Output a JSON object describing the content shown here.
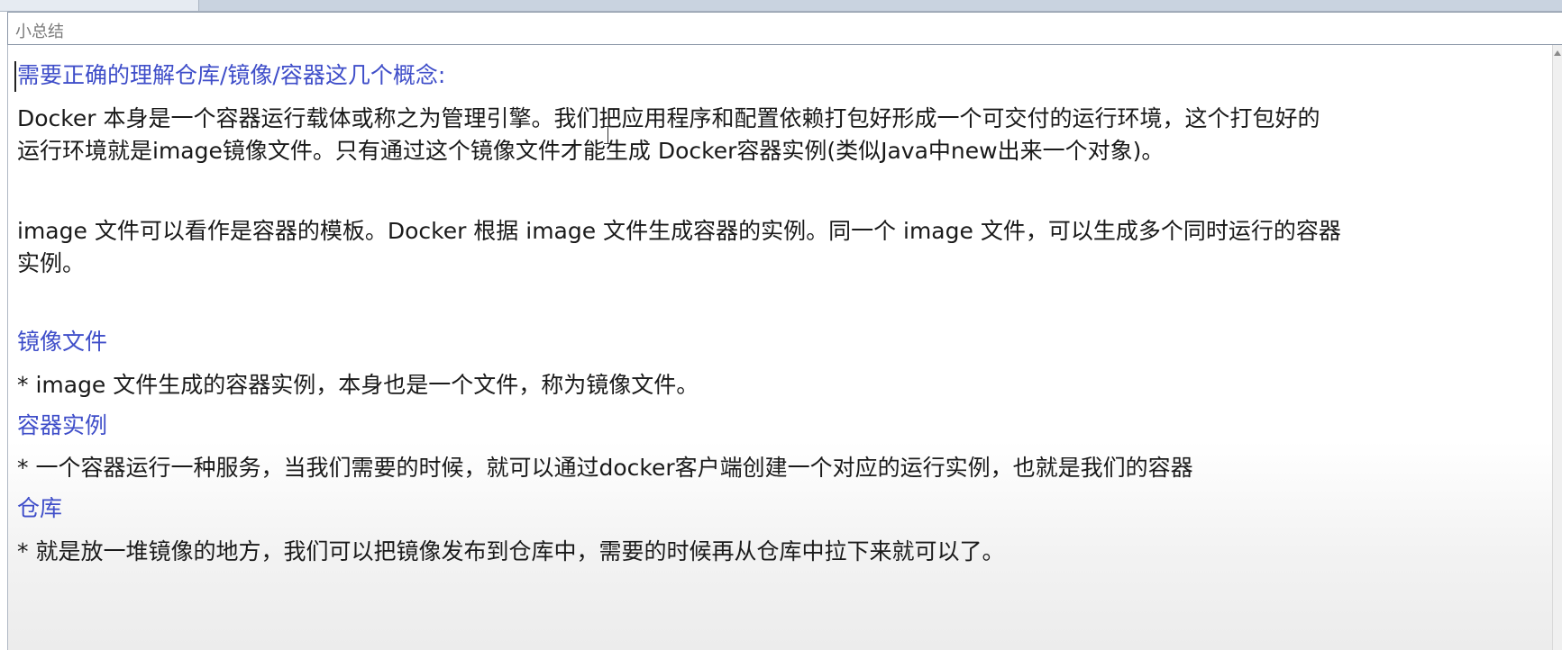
{
  "window": {
    "title": "小总结"
  },
  "content": {
    "heading_main": "需要正确的理解仓库/镜像/容器这几个概念:",
    "para1_line1": "Docker 本身是一个容器运行载体或称之为管理引擎。我们把应用程序和配置依赖打包好形成一个可交付的运行环境，这个打包好的",
    "para1_line2": "运行环境就是image镜像文件。只有通过这个镜像文件才能生成 Docker容器实例(类似Java中new出来一个对象)。",
    "para2_line1": "image 文件可以看作是容器的模板。Docker 根据 image 文件生成容器的实例。同一个 image 文件，可以生成多个同时运行的容器",
    "para2_line2": "实例。",
    "section_image": {
      "heading": "镜像文件",
      "text": "*  image 文件生成的容器实例，本身也是一个文件，称为镜像文件。"
    },
    "section_container": {
      "heading": "容器实例",
      "text": "*  一个容器运行一种服务，当我们需要的时候，就可以通过docker客户端创建一个对应的运行实例，也就是我们的容器"
    },
    "section_repo": {
      "heading": "仓库",
      "text": "* 就是放一堆镜像的地方，我们可以把镜像发布到仓库中，需要的时候再从仓库中拉下来就可以了。"
    }
  },
  "colors": {
    "heading": "#3f4ec9",
    "body_text": "#1a1a1a",
    "title_text": "#7a7a7a"
  }
}
